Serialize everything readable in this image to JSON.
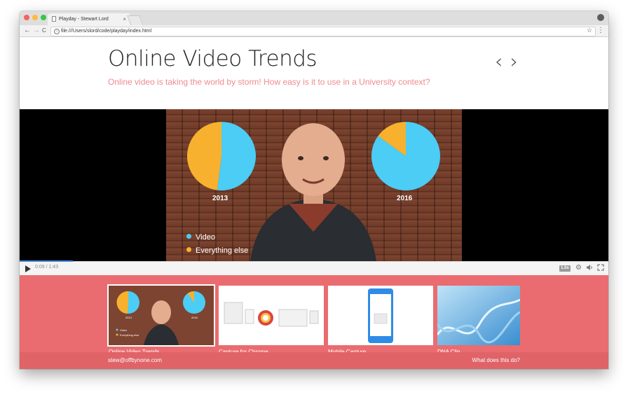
{
  "browser": {
    "tab_title": "Playday - Stewart Lord",
    "tab_close": "×",
    "url": "file:///Users/slord/code/playday/index.html",
    "back": "←",
    "forward": "→",
    "reload": "C",
    "star": "☆",
    "menu": "⋮",
    "traffic_colors": [
      "#fc605b",
      "#fdbc40",
      "#34c84a"
    ]
  },
  "page": {
    "title": "Online Video Trends",
    "subtitle": "Online video is taking the world by storm! How easy is it to use in a University context?",
    "prev": "‹",
    "next": "›",
    "accent": "#ea6c70"
  },
  "video": {
    "chart_data": {
      "type": "pie",
      "charts": [
        {
          "label": "2013",
          "slices": [
            {
              "name": "Video",
              "value": 52
            },
            {
              "name": "Everything else",
              "value": 48
            }
          ]
        },
        {
          "label": "2016",
          "slices": [
            {
              "name": "Video",
              "value": 85
            },
            {
              "name": "Everything else",
              "value": 15
            }
          ]
        }
      ],
      "legend": [
        "Video",
        "Everything else"
      ],
      "colors": {
        "Video": "#4bcdf5",
        "Everything else": "#f7b12e"
      }
    },
    "time": "0:09 / 1:43",
    "progress": 0.09,
    "speed": "1.0x",
    "icons": [
      "play-icon",
      "settings-icon",
      "volume-icon",
      "fullscreen-icon"
    ]
  },
  "playlist": [
    {
      "title": "Online Video Trends",
      "active": true
    },
    {
      "title": "Capture for Chrome",
      "active": false
    },
    {
      "title": "Mobile Capture",
      "active": false
    },
    {
      "title": "DNA Clip",
      "active": false
    }
  ],
  "footer": {
    "email": "stew@offbynone.com",
    "link": "What does this do?"
  }
}
